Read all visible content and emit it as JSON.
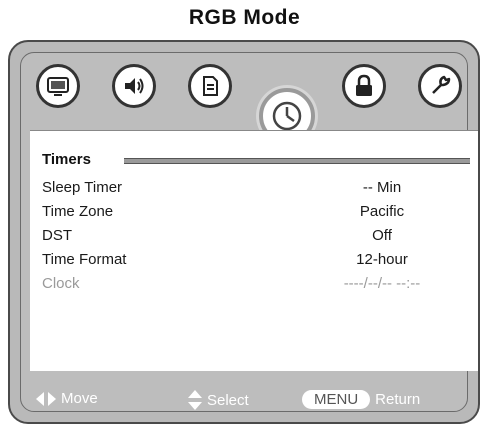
{
  "page_title": "RGB Mode",
  "menu_icons": [
    {
      "name": "picture-icon"
    },
    {
      "name": "audio-icon"
    },
    {
      "name": "document-icon"
    },
    {
      "name": "clock-icon",
      "active": true
    },
    {
      "name": "lock-icon"
    },
    {
      "name": "wrench-icon"
    }
  ],
  "section": {
    "title": "Timers"
  },
  "rows": [
    {
      "label": "Sleep Timer",
      "value": "-- Min",
      "enabled": true
    },
    {
      "label": "Time Zone",
      "value": "Pacific",
      "enabled": true
    },
    {
      "label": "DST",
      "value": "Off",
      "enabled": true
    },
    {
      "label": "Time Format",
      "value": "12-hour",
      "enabled": true
    },
    {
      "label": "Clock",
      "value": "----/--/-- --:--",
      "enabled": false
    }
  ],
  "footer": {
    "move_label": "Move",
    "select_label": "Select",
    "menu_label": "MENU",
    "return_label": "Return"
  }
}
